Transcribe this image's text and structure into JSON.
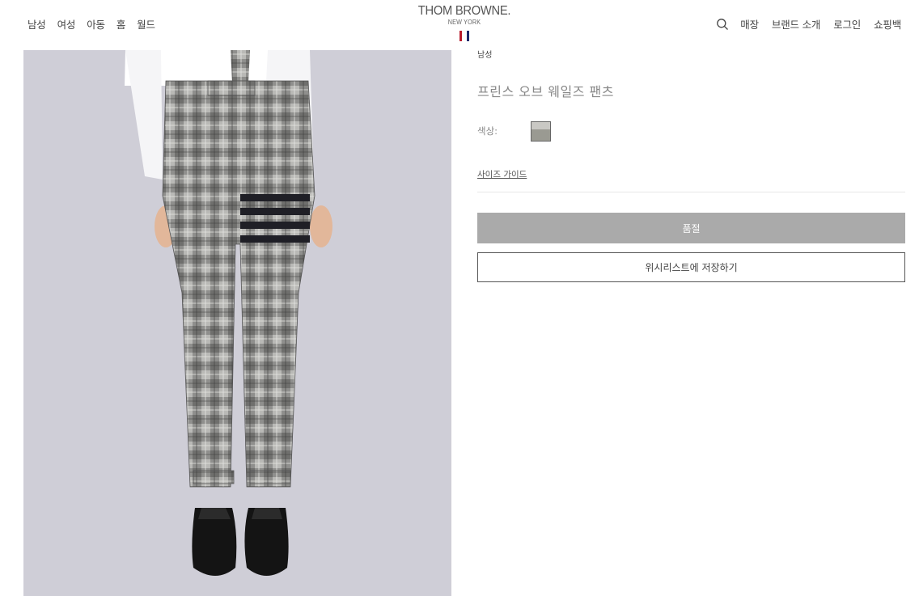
{
  "header": {
    "left_nav": [
      {
        "label": "남성"
      },
      {
        "label": "여성"
      },
      {
        "label": "아동"
      },
      {
        "label": "홈"
      },
      {
        "label": "월드"
      }
    ],
    "logo": {
      "brand": "THOM BROWNE.",
      "city": "NEW YORK",
      "flag_colors": [
        "#b81c2c",
        "#ffffff",
        "#1b2a6b"
      ]
    },
    "right_nav": [
      {
        "label": "매장"
      },
      {
        "label": "브랜드 소개"
      },
      {
        "label": "로그인"
      },
      {
        "label": "쇼핑백"
      }
    ],
    "search_icon": "search-icon"
  },
  "product": {
    "category": "남성",
    "title": "프린스 오브 웨일즈 팬츠",
    "color_label": "색상:",
    "swatches": [
      {
        "name": "grey"
      }
    ],
    "size_guide": "사이즈 가이드",
    "soldout_label": "품절",
    "wishlist_label": "위시리스트에 저장하기",
    "colors": {
      "soldout_bg": "#aaaaaa",
      "image_bg": "#cfced7"
    }
  }
}
